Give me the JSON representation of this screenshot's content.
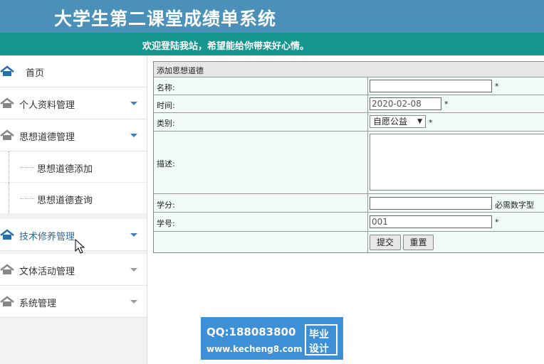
{
  "header": {
    "title": "大学生第二课堂成绩单系统",
    "welcome": "欢迎登陆我站，希望能给你带来好心情。"
  },
  "sidebar": {
    "home": "首页",
    "items": [
      {
        "label": "个人资料管理"
      },
      {
        "label": "思想道德管理"
      },
      {
        "label": "思想道德添加"
      },
      {
        "label": "思想道德查询"
      },
      {
        "label": "技术修养管理"
      },
      {
        "label": "文体活动管理"
      },
      {
        "label": "系统管理"
      }
    ]
  },
  "form": {
    "title": "添加思想道德",
    "fields": {
      "name": {
        "label": "名称:",
        "value": ""
      },
      "time": {
        "label": "时间:",
        "value": "2020-02-08"
      },
      "category": {
        "label": "类别:",
        "value": "自愿公益"
      },
      "description": {
        "label": "描述:",
        "value": ""
      },
      "credit": {
        "label": "学分:",
        "value": "",
        "hint": "必需数字型"
      },
      "student_id": {
        "label": "学号:",
        "value": "001"
      }
    },
    "required_mark": "*",
    "submit": "提交",
    "reset": "重置"
  },
  "watermark": {
    "qq": "QQ:188083800",
    "url": "www.kecheng8.com",
    "badge_line1": "毕业",
    "badge_line2": "设计"
  },
  "colors": {
    "banner": "#4a90b8",
    "welcome_bar": "#15968e",
    "accent": "#3a7fc0"
  }
}
